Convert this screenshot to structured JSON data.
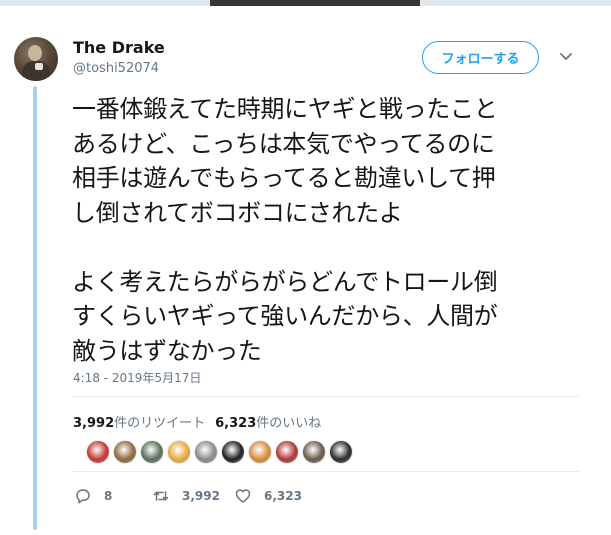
{
  "tweet": {
    "author": {
      "name": "The Drake",
      "handle": "@toshi52074"
    },
    "follow_label": "フォローする",
    "text_lines": [
      "一番体鍛えてた時期にヤギと戦ったこと",
      "あるけど、こっちは本気でやってるのに",
      "相手は遊んでもらってると勘違いして押",
      "し倒されてボコボコにされたよ",
      "",
      "よく考えたらがらがらどんでトロール倒",
      "すくらいヤギって強いんだから、人間が",
      "敵うはずなかった"
    ],
    "timestamp": "4:18 - 2019年5月17日",
    "stats": {
      "retweet_count": "3,992",
      "retweet_label": "件のリツイート",
      "like_count": "6,323",
      "like_label": "件のいいね"
    },
    "liker_avatars": [
      {
        "color": "#c2362f",
        "icon": "avatar-red"
      },
      {
        "color": "#8a6a3a",
        "icon": "avatar-brown"
      },
      {
        "color": "#5a6e5a",
        "icon": "avatar-green"
      },
      {
        "color": "#e8a93a",
        "icon": "avatar-yellow"
      },
      {
        "color": "#8a8a8a",
        "icon": "avatar-gray"
      },
      {
        "color": "#1e1e1e",
        "icon": "avatar-black"
      },
      {
        "color": "#d98a3a",
        "icon": "avatar-orange"
      },
      {
        "color": "#b0343a",
        "icon": "avatar-crimson"
      },
      {
        "color": "#6a5a4a",
        "icon": "avatar-dark-brown"
      },
      {
        "color": "#2a2a2a",
        "icon": "avatar-charcoal"
      }
    ],
    "actions": {
      "reply_count": "8",
      "retweet_count": "3,992",
      "like_count": "6,323"
    }
  }
}
